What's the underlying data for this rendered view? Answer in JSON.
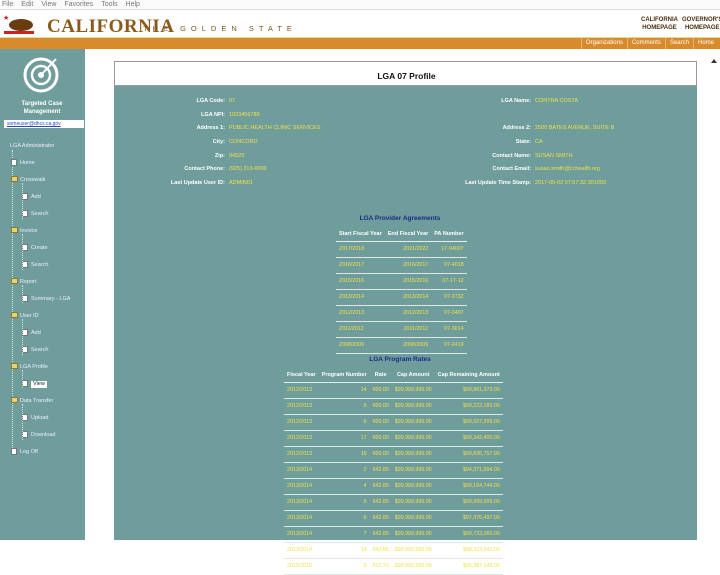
{
  "menu": [
    "File",
    "Edit",
    "View",
    "Favorites",
    "Tools",
    "Help"
  ],
  "header": {
    "brand": "CALIFORNIA",
    "tagline": "THE GOLDEN STATE",
    "links": [
      [
        "CALIFORNIA",
        "HOMEPAGE"
      ],
      [
        "GOVERNOR'S",
        "HOMEPAGE"
      ]
    ]
  },
  "nav": [
    "Organizations",
    "Comments",
    "Search",
    "Home"
  ],
  "sidebar": {
    "app_name": "Targeted Case Management",
    "user": "someuser@dhcs.ca.gov",
    "tree": [
      "LGA Administrator",
      "Home",
      "Crosswalk",
      "Add",
      "Search",
      "Invoice",
      "Create",
      "Search",
      "Report",
      "Summary - LGA",
      "User ID",
      "Add",
      "Search",
      "LGA Profile",
      "View",
      "Data Transfer",
      "Upload",
      "Download",
      "Log Off"
    ]
  },
  "page": {
    "title": "LGA 07 Profile"
  },
  "fields_left": [
    {
      "label": "LGA Code:",
      "value": "07"
    },
    {
      "label": "LGA NPI:",
      "value": "1023456789"
    },
    {
      "label": "Address 1:",
      "value": "PUBLIC HEALTH CLINIC SERVICES"
    },
    {
      "label": "City:",
      "value": "CONCORD"
    },
    {
      "label": "Zip:",
      "value": "94520"
    },
    {
      "label": "Contact Phone:",
      "value": "(925) 313-6000"
    },
    {
      "label": "Last Update User ID:",
      "value": "ADMIN01"
    }
  ],
  "fields_right": [
    {
      "label": "LGA Name:",
      "value": "CONTRA COSTA"
    },
    {
      "label": "Address 2:",
      "value": "2500 BATES AVENUE, SUITE B"
    },
    {
      "label": "State:",
      "value": "CA"
    },
    {
      "label": "Contact Name:",
      "value": "SUSAN SMITH"
    },
    {
      "label": "Contact Email:",
      "value": "susan.smith@cchealth.org"
    },
    {
      "label": "Last Update Time Stamp:",
      "value": "2017-05-02 07:57:32.301093"
    }
  ],
  "agreements": {
    "title": "LGA Provider Agreements",
    "headers": [
      "Start Fiscal Year",
      "End Fiscal Year",
      "PA Number"
    ],
    "rows": [
      [
        "2017/2018",
        "2021/2022",
        "17-94007"
      ],
      [
        "2016/2017",
        "2016/2017",
        "07-4018"
      ],
      [
        "2015/2016",
        "2015/2016",
        "07-17-12"
      ],
      [
        "2013/2014",
        "2013/2014",
        "07-3732"
      ],
      [
        "2012/2013",
        "2012/2013",
        "07-3407"
      ],
      [
        "2011/2012",
        "2011/2012",
        "07-3014"
      ],
      [
        "2008/2009",
        "2008/2009",
        "07-2419"
      ]
    ]
  },
  "rates": {
    "title": "LGA Program Rates",
    "headers": [
      "Fiscal Year",
      "Program Number",
      "Rate",
      "Cap Amount",
      "Cap Remaining Amount"
    ],
    "rows": [
      [
        "2012/2013",
        "14",
        "600.00",
        "$99,999,999.00",
        "$99,861,373.00"
      ],
      [
        "2012/2013",
        "5",
        "600.00",
        "$99,999,999.00",
        "$99,222,183.00"
      ],
      [
        "2012/2013",
        "6",
        "600.00",
        "$99,999,999.00",
        "$99,927,399.00"
      ],
      [
        "2012/2013",
        "17",
        "600.00",
        "$99,999,999.00",
        "$99,342,400.00"
      ],
      [
        "2012/2013",
        "16",
        "600.00",
        "$99,999,999.00",
        "$99,836,757.00"
      ],
      [
        "2013/2014",
        "2",
        "642.85",
        "$99,999,999.00",
        "$94,371,504.00"
      ],
      [
        "2013/2014",
        "4",
        "642.85",
        "$99,999,999.00",
        "$99,164,744.00"
      ],
      [
        "2013/2014",
        "5",
        "642.85",
        "$99,999,999.00",
        "$99,999,999.00"
      ],
      [
        "2013/2014",
        "6",
        "642.85",
        "$99,999,999.00",
        "$97,376,497.00"
      ],
      [
        "2013/2014",
        "7",
        "642.85",
        "$99,999,999.00",
        "$99,733,260.00"
      ],
      [
        "2013/2014",
        "14",
        "642.85",
        "$99,999,999.00",
        "$98,323,041.00"
      ],
      [
        "2015/2016",
        "5",
        "512.70",
        "$99,999,999.00",
        "$95,387,149.00"
      ]
    ]
  }
}
